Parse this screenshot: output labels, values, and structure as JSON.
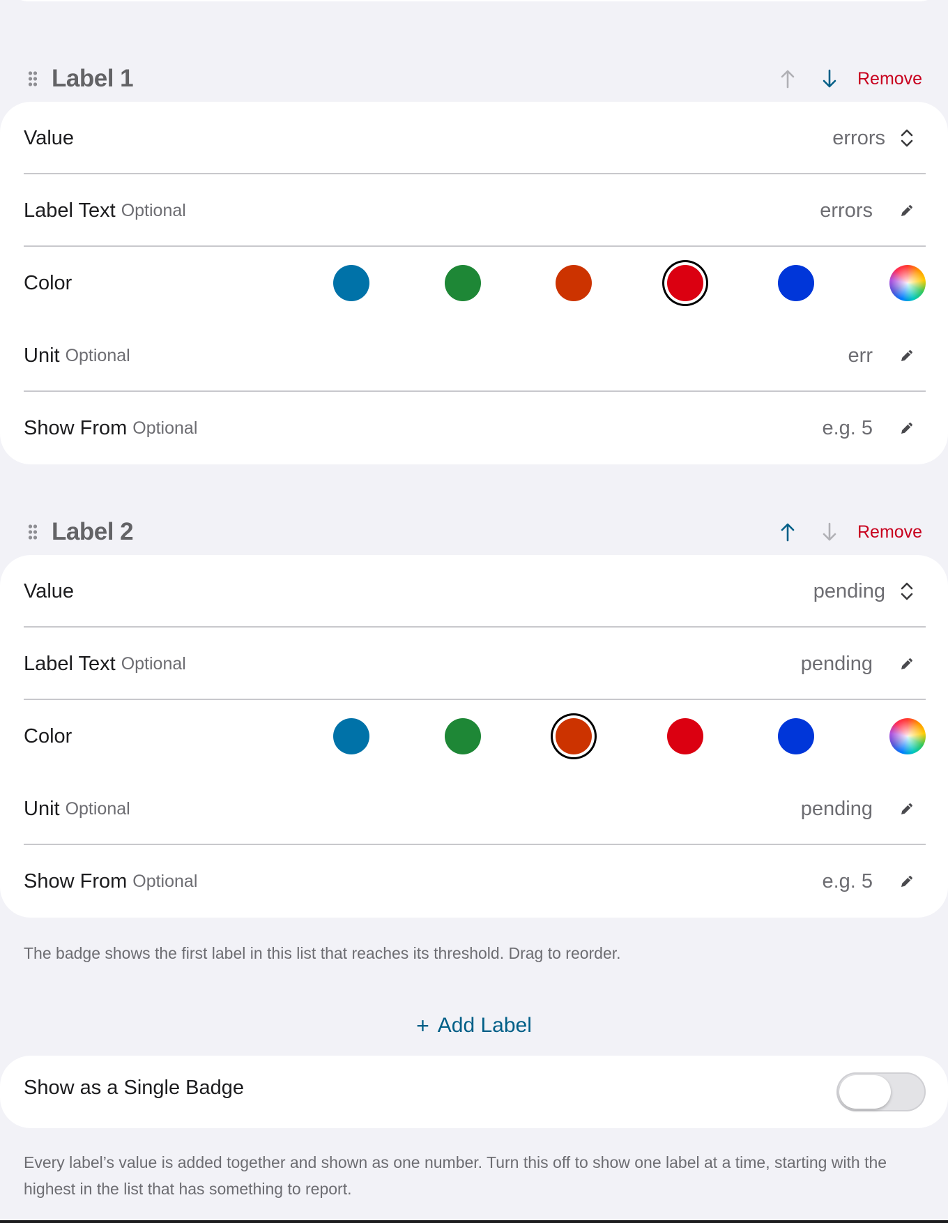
{
  "labels": [
    {
      "title": "Label 1",
      "remove": "Remove",
      "value_row": {
        "label": "Value",
        "value": "errors"
      },
      "label_text_row": {
        "label": "Label Text",
        "optional": "Optional",
        "value": "errors"
      },
      "color_row": {
        "label": "Color",
        "selected": "red"
      },
      "unit_row": {
        "label": "Unit",
        "optional": "Optional",
        "value": "err"
      },
      "show_from_row": {
        "label": "Show From",
        "optional": "Optional",
        "placeholder": "e.g. 5"
      },
      "move_up_enabled": false,
      "move_down_enabled": true
    },
    {
      "title": "Label 2",
      "remove": "Remove",
      "value_row": {
        "label": "Value",
        "value": "pending"
      },
      "label_text_row": {
        "label": "Label Text",
        "optional": "Optional",
        "value": "pending"
      },
      "color_row": {
        "label": "Color",
        "selected": "orange"
      },
      "unit_row": {
        "label": "Unit",
        "optional": "Optional",
        "value": "pending"
      },
      "show_from_row": {
        "label": "Show From",
        "optional": "Optional",
        "placeholder": "e.g. 5"
      },
      "move_up_enabled": true,
      "move_down_enabled": false
    }
  ],
  "colors": {
    "blue_teal": "#0072a8",
    "green": "#1e8736",
    "orange": "#cc3300",
    "red": "#db0011",
    "blue": "#0036d9",
    "accent": "#005f87",
    "destructive": "#c8001e"
  },
  "footnote_order": "The badge shows the first label in this list that reaches its threshold. Drag to reorder.",
  "add_label": {
    "plus": "+",
    "text": "Add Label"
  },
  "single_badge": {
    "label": "Show as a Single Badge",
    "on": false
  },
  "footnote_single": "Every label’s value is added together and shown as one number. Turn this off to show one label at a time, starting with the highest in the list that has something to report."
}
